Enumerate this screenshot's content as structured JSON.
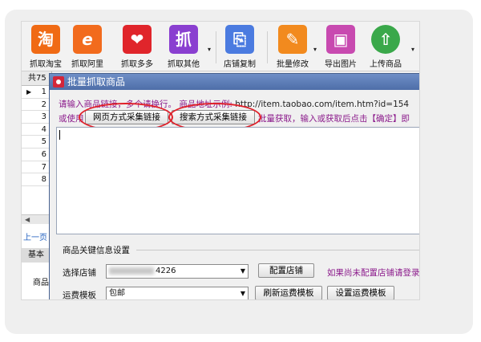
{
  "toolbar": {
    "buttons": [
      {
        "label": "抓取淘宝",
        "icon": "taobao-icon",
        "glyph": "淘",
        "color": "#f06a14"
      },
      {
        "label": "抓取阿里",
        "icon": "alibaba-icon",
        "glyph": "e",
        "color": "#f26b1d"
      },
      {
        "label": "抓取多多",
        "icon": "pinduoduo-icon",
        "glyph": "❤",
        "color": "#e0252b"
      },
      {
        "label": "抓取其他",
        "icon": "grab-other-icon",
        "glyph": "抓",
        "color": "#8a3fd0"
      },
      {
        "label": "店铺复制",
        "icon": "shop-copy-icon",
        "glyph": "⎘",
        "color": "#4b7be0"
      },
      {
        "label": "批量修改",
        "icon": "batch-edit-icon",
        "glyph": "✎",
        "color": "#f28a1e"
      },
      {
        "label": "导出图片",
        "icon": "export-image-icon",
        "glyph": "▣",
        "color": "#c84ab0"
      },
      {
        "label": "上传商品",
        "icon": "upload-goods-icon",
        "glyph": "⇧",
        "color": "#3aa84a"
      }
    ]
  },
  "left_panel": {
    "header": "共75",
    "rows": [
      "1",
      "2",
      "3",
      "4",
      "5",
      "6",
      "7",
      "8"
    ],
    "prev_label": "上一页",
    "tab_label": "基本",
    "goods_label": "商品"
  },
  "dialog": {
    "title": "批量抓取商品",
    "instruction": "请输入商品链接，多个请换行。 商品地址示例:",
    "example_url": "http://item.taobao.com/item.htm?id=154",
    "or_use": "或使用",
    "web_collect_button": "网页方式采集链接",
    "search_collect_button": "搜索方式采集链接",
    "after_buttons": "批量获取，输入或获取后点击【确定】即",
    "links_value": "",
    "group_title": "商品关键信息设置",
    "shop_label": "选择店铺",
    "shop_value": "4226",
    "config_shop_button": "配置店铺",
    "config_hint": "如果尚未配置店铺请登录",
    "freight_label": "运费模板",
    "freight_value": "包邮",
    "refresh_freight_button": "刷新运费模板",
    "set_freight_button": "设置运费模板"
  },
  "colors": {
    "titlebar": "#5a7ab4",
    "hint_text": "#8b1a8b",
    "highlight_oval": "#e0202a"
  }
}
